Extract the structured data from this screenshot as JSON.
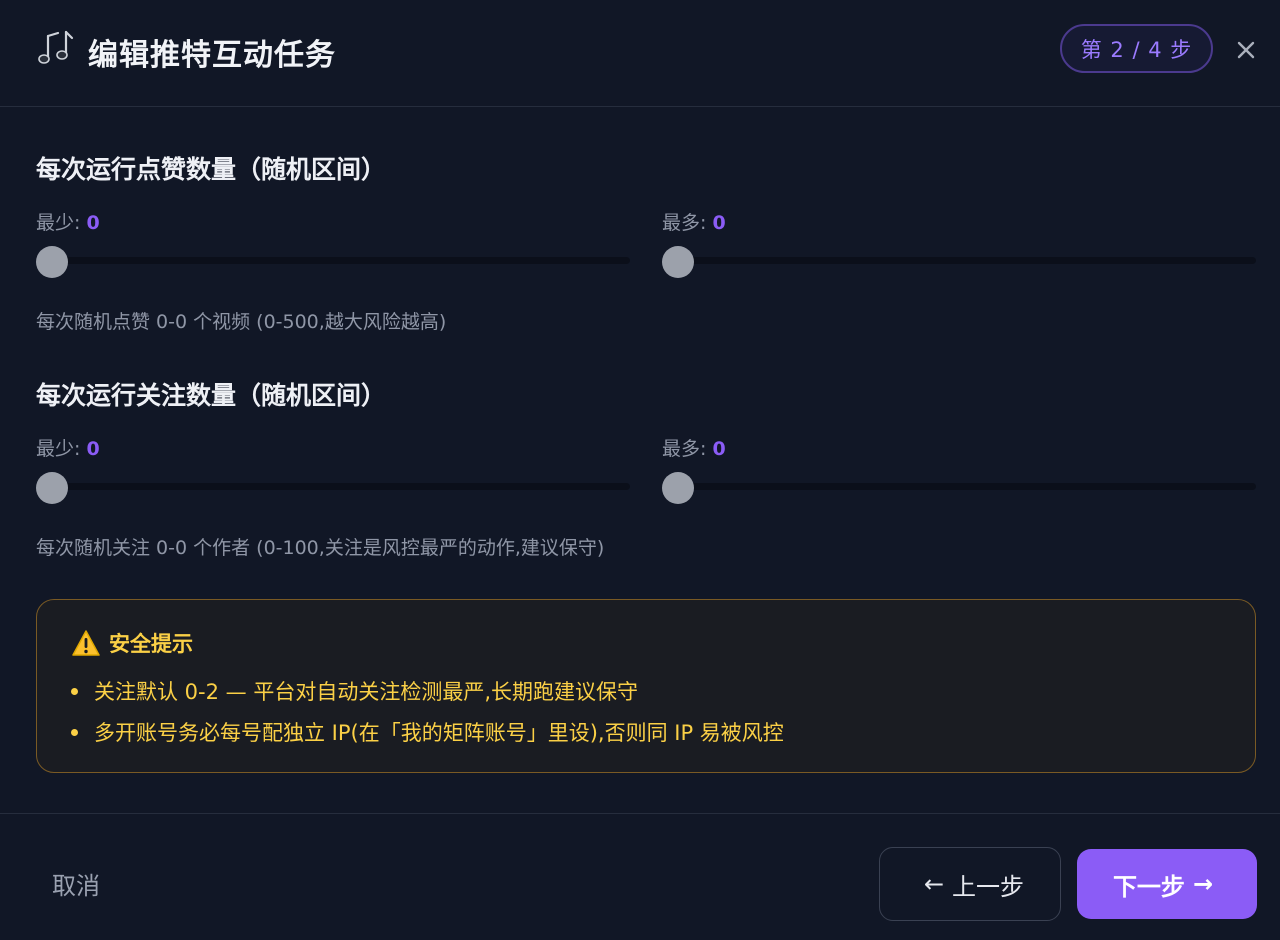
{
  "header": {
    "icon": "music-notes-icon",
    "title": "编辑推特互动任务",
    "step_badge": "第 2 / 4 步",
    "close_icon": "close-icon"
  },
  "likes": {
    "title": "每次运行点赞数量（随机区间）",
    "min_label": "最少: ",
    "min_value": "0",
    "max_label": "最多: ",
    "max_value": "0",
    "hint": "每次随机点赞 0-0 个视频 (0-500,越大风险越高)"
  },
  "follows": {
    "title": "每次运行关注数量（随机区间）",
    "min_label": "最少: ",
    "min_value": "0",
    "max_label": "最多: ",
    "max_value": "0",
    "hint": "每次随机关注 0-0 个作者 (0-100,关注是风控最严的动作,建议保守)"
  },
  "warning": {
    "icon": "warning-icon",
    "title": "安全提示",
    "items": [
      "关注默认 0-2 — 平台对自动关注检测最严,长期跑建议保守",
      "多开账号务必每号配独立 IP(在「我的矩阵账号」里设),否则同 IP 易被风控"
    ]
  },
  "footer": {
    "cancel_label": "取消",
    "prev_label": "上一步",
    "prev_arrow": "←",
    "next_label": "下一步",
    "next_arrow": "→"
  },
  "colors": {
    "accent": "#8b5cf6",
    "background": "#111726",
    "warning": "#fbd046"
  }
}
